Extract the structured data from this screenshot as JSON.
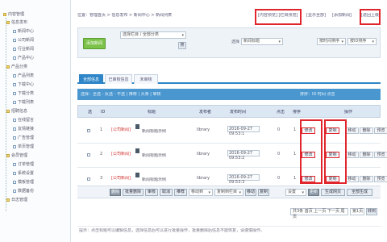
{
  "colors": {
    "accent_blue": "#2e86c8",
    "green_button": "#7cc24a",
    "highlight_red": "#e0262c"
  },
  "sidebar": {
    "root_label": "内容管理",
    "nodes": [
      {
        "label": "信息发布"
      },
      {
        "label": "新闻中心"
      },
      {
        "label": "公司新闻"
      },
      {
        "label": "行业新闻"
      },
      {
        "label": "产品中心"
      },
      {
        "label": "产品分类"
      },
      {
        "label": "产品列表"
      },
      {
        "label": "下载中心"
      },
      {
        "label": "下载分类"
      },
      {
        "label": "下载列表"
      },
      {
        "label": "招聘信息"
      },
      {
        "label": "在线留言"
      },
      {
        "label": "友情链接"
      },
      {
        "label": "广告管理"
      },
      {
        "label": "单页管理"
      },
      {
        "label": "会员管理"
      },
      {
        "label": "订单管理"
      },
      {
        "label": "系统设置"
      },
      {
        "label": "模板管理"
      },
      {
        "label": "数据备份"
      },
      {
        "label": "日志管理"
      }
    ]
  },
  "header": {
    "breadcrumb": "位置：管理首页 > 信息发布 > 新闻中心 > 新闻列表",
    "link_1": "[内容预览] [栏目预览]",
    "link_2": "[显示全部]",
    "link_3": "[添加新闻]",
    "link_4": "[返回上级]"
  },
  "search": {
    "add_button": "添加新闻",
    "column_select": "选择栏目 / 全部分类",
    "go_button": "搜",
    "field_label": "选择",
    "field_select": "新闻标题",
    "sort_select": "按时间排序",
    "order_select": "按ID排序"
  },
  "tabs": [
    {
      "label": "全部信息"
    },
    {
      "label": "已审核信息"
    },
    {
      "label": "未审核"
    }
  ],
  "toolbar_strip": {
    "left_text": "选择：全选 - 反选 - 不选 | 推荐 | 头条 | 审核",
    "right_text": "排序：ID 时间 点击"
  },
  "table": {
    "headers": [
      "选",
      "ID",
      "标题",
      "发布者",
      "发布时间",
      "点击",
      "排序",
      "操作"
    ],
    "rows": [
      {
        "id": "1",
        "title": "[公司新闻]",
        "title_sub": "新闻标题示例",
        "author": "library",
        "date": "2016-09-27 09:53:1",
        "clicks": "0",
        "order": "1",
        "ops": [
          "修改",
          "复制",
          "移动",
          "删除",
          "预览"
        ]
      },
      {
        "id": "2",
        "title": "[公司新闻]",
        "title_sub": "新闻标题示例",
        "author": "library",
        "date": "2016-09-27 09:53:2",
        "clicks": "0",
        "order": "1",
        "ops": [
          "修改",
          "复制",
          "移动",
          "删除",
          "预览"
        ]
      },
      {
        "id": "3",
        "title": "[公司新闻]",
        "title_sub": "新闻标题示例",
        "author": "library",
        "date": "2016-09-27 09:53:3",
        "clicks": "0",
        "order": "1",
        "ops": [
          "修改",
          "复制",
          "移动",
          "删除",
          "预览"
        ]
      }
    ]
  },
  "actions": {
    "buttons": [
      "删除",
      "批量删除",
      "审核",
      "取消",
      "推荐"
    ],
    "select_1": "移动到",
    "select_2": "复制到栏目",
    "btn_move": "移动",
    "btn_copy": "复制",
    "select_3": "设置",
    "btn_update": "更新",
    "btn_generate": "生成网页",
    "btn_generate_all": "全部生成"
  },
  "pagination": {
    "text": "共3条 首页 上一页 下一页 尾页",
    "page_select": "第1页",
    "go": "转到"
  },
  "footer": {
    "note": "提示：点击标题可以编辑信息，选择信息后可以进行批量操作，批量删除后信息不能恢复，请谨慎操作。"
  }
}
